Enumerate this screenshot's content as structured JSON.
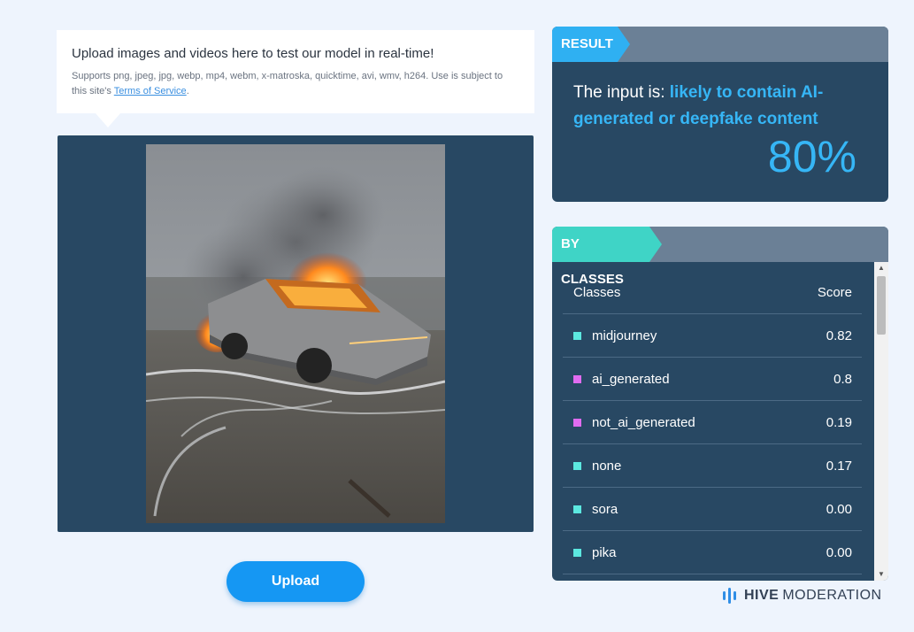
{
  "upload_info": {
    "title": "Upload images and videos here to test our model in real-time!",
    "subtitle": "Supports png, jpeg, jpg, webp, mp4, webm, x-matroska, quicktime, avi, wmv, h264. Use is subject to this site's",
    "tos_link": "Terms of Service",
    "subtitle_end": "."
  },
  "upload_button": "Upload",
  "result": {
    "tag": "RESULT",
    "prefix": "The input is:",
    "verdict": "likely to contain AI-generated or deepfake content",
    "percent": "80%",
    "accent": "#36b6f6"
  },
  "by_classes": {
    "tag": "BY CLASSES",
    "header": {
      "name": "Classes",
      "score": "Score"
    },
    "rows": [
      {
        "name": "midjourney",
        "score": "0.82",
        "color": "#5ce8e0"
      },
      {
        "name": "ai_generated",
        "score": "0.8",
        "color": "#e06cf0"
      },
      {
        "name": "not_ai_generated",
        "score": "0.19",
        "color": "#e06cf0"
      },
      {
        "name": "none",
        "score": "0.17",
        "color": "#5ce8e0"
      },
      {
        "name": "sora",
        "score": "0.00",
        "color": "#5ce8e0"
      },
      {
        "name": "pika",
        "score": "0.00",
        "color": "#5ce8e0"
      }
    ]
  },
  "logo": {
    "brand": "HIVE",
    "product": "MODERATION"
  }
}
